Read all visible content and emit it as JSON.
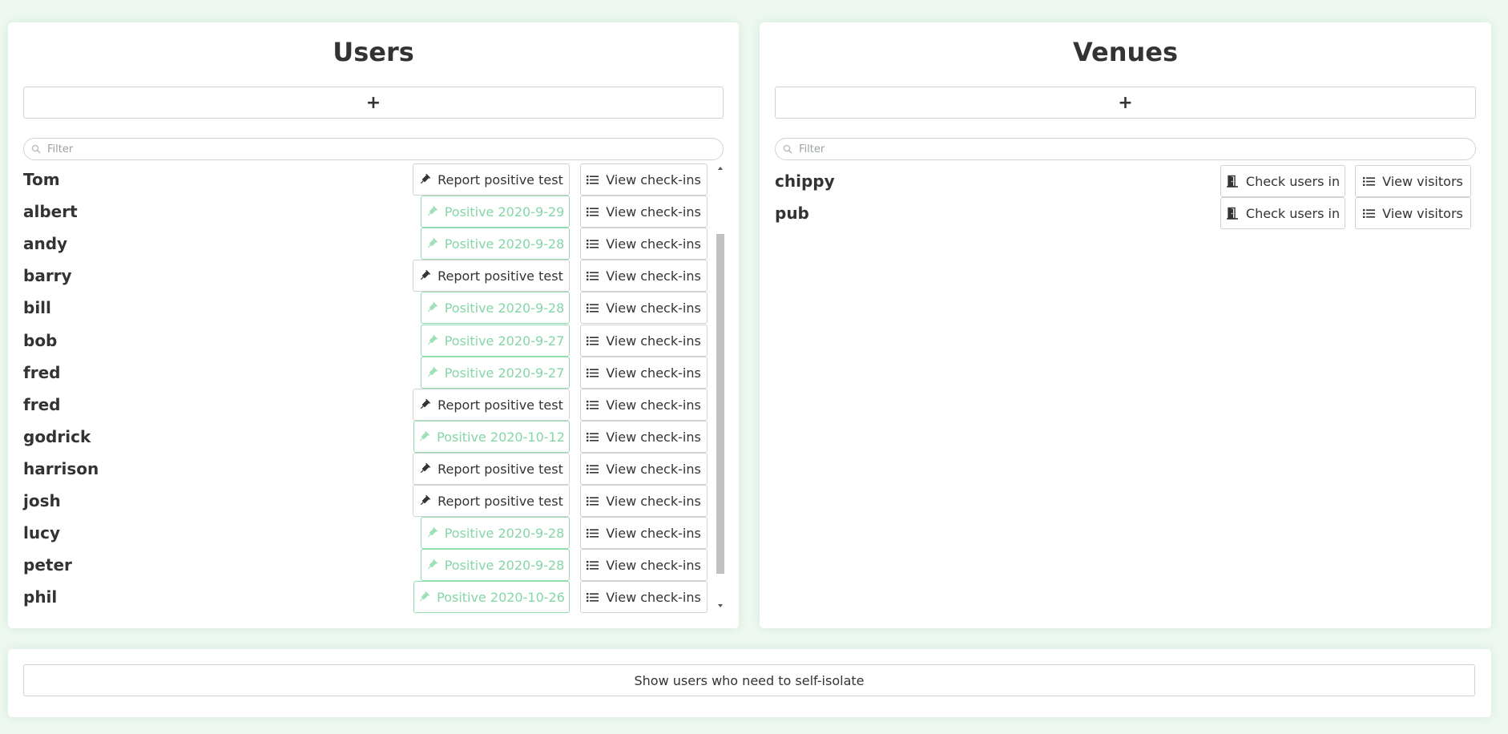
{
  "users_panel": {
    "title": "Users",
    "add_label": "+",
    "filter_placeholder": "Filter",
    "rows": [
      {
        "name": "Tom",
        "status": "Report positive test",
        "positive": false,
        "checkins": "View check-ins"
      },
      {
        "name": "albert",
        "status": "Positive 2020-9-29",
        "positive": true,
        "checkins": "View check-ins"
      },
      {
        "name": "andy",
        "status": "Positive 2020-9-28",
        "positive": true,
        "checkins": "View check-ins"
      },
      {
        "name": "barry",
        "status": "Report positive test",
        "positive": false,
        "checkins": "View check-ins"
      },
      {
        "name": "bill",
        "status": "Positive 2020-9-28",
        "positive": true,
        "checkins": "View check-ins"
      },
      {
        "name": "bob",
        "status": "Positive 2020-9-27",
        "positive": true,
        "checkins": "View check-ins"
      },
      {
        "name": "fred",
        "status": "Positive 2020-9-27",
        "positive": true,
        "checkins": "View check-ins"
      },
      {
        "name": "fred",
        "status": "Report positive test",
        "positive": false,
        "checkins": "View check-ins"
      },
      {
        "name": "godrick",
        "status": "Positive 2020-10-12",
        "positive": true,
        "checkins": "View check-ins"
      },
      {
        "name": "harrison",
        "status": "Report positive test",
        "positive": false,
        "checkins": "View check-ins"
      },
      {
        "name": "josh",
        "status": "Report positive test",
        "positive": false,
        "checkins": "View check-ins"
      },
      {
        "name": "lucy",
        "status": "Positive 2020-9-28",
        "positive": true,
        "checkins": "View check-ins"
      },
      {
        "name": "peter",
        "status": "Positive 2020-9-28",
        "positive": true,
        "checkins": "View check-ins"
      },
      {
        "name": "phil",
        "status": "Positive 2020-10-26",
        "positive": true,
        "checkins": "View check-ins"
      }
    ]
  },
  "venues_panel": {
    "title": "Venues",
    "add_label": "+",
    "filter_placeholder": "Filter",
    "rows": [
      {
        "name": "chippy",
        "checkin_label": "Check users in",
        "visitors_label": "View visitors"
      },
      {
        "name": "pub",
        "checkin_label": "Check users in",
        "visitors_label": "View visitors"
      }
    ]
  },
  "footer": {
    "isolate_label": "Show users who need to self-isolate"
  },
  "colors": {
    "background": "#eef8f0",
    "positive_text": "#84d7a6",
    "positive_border": "#8fdcaf",
    "text": "#333333"
  },
  "icons": {
    "test": "syringe-icon",
    "list": "list-icon",
    "door": "door-icon",
    "search": "search-icon"
  }
}
